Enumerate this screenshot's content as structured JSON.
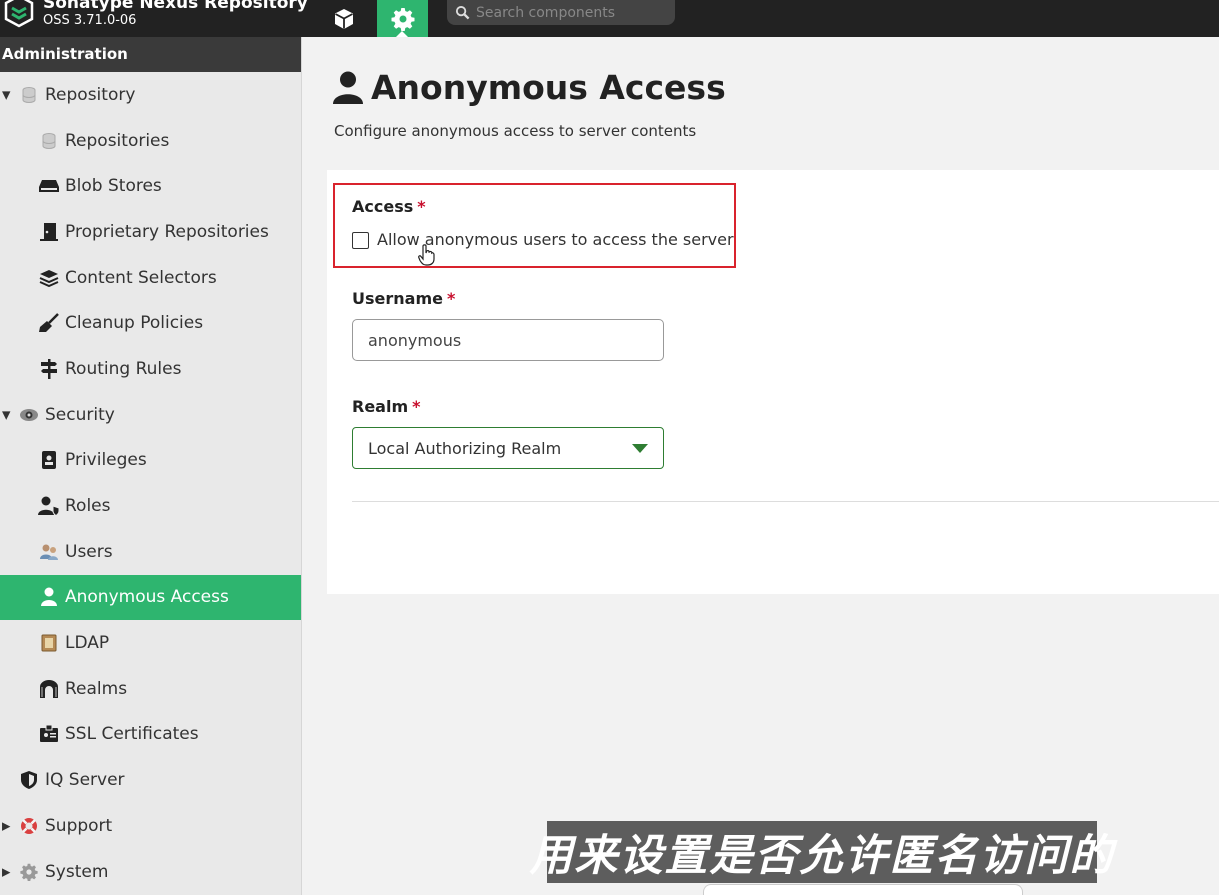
{
  "header": {
    "app_title": "Sonatype Nexus Repository",
    "version": "OSS 3.71.0-06",
    "search_placeholder": "Search components"
  },
  "sidebar": {
    "title": "Administration",
    "items": [
      {
        "label": "Repository",
        "level": 1,
        "expanded": true,
        "icon": "database-icon"
      },
      {
        "label": "Repositories",
        "level": 2,
        "icon": "database-icon"
      },
      {
        "label": "Blob Stores",
        "level": 2,
        "icon": "hard-drive-icon"
      },
      {
        "label": "Proprietary Repositories",
        "level": 2,
        "icon": "door-icon"
      },
      {
        "label": "Content Selectors",
        "level": 2,
        "icon": "layers-icon"
      },
      {
        "label": "Cleanup Policies",
        "level": 2,
        "icon": "broom-icon"
      },
      {
        "label": "Routing Rules",
        "level": 2,
        "icon": "signpost-icon"
      },
      {
        "label": "Security",
        "level": 1,
        "expanded": true,
        "icon": "eye-icon"
      },
      {
        "label": "Privileges",
        "level": 2,
        "icon": "id-badge-icon"
      },
      {
        "label": "Roles",
        "level": 2,
        "icon": "user-shield-icon"
      },
      {
        "label": "Users",
        "level": 2,
        "icon": "users-icon"
      },
      {
        "label": "Anonymous Access",
        "level": 2,
        "active": true,
        "icon": "user-icon"
      },
      {
        "label": "LDAP",
        "level": 2,
        "icon": "address-book-icon"
      },
      {
        "label": "Realms",
        "level": 2,
        "icon": "archway-icon"
      },
      {
        "label": "SSL Certificates",
        "level": 2,
        "icon": "id-card-icon"
      },
      {
        "label": "IQ Server",
        "level": 1,
        "icon": "shield-icon"
      },
      {
        "label": "Support",
        "level": 1,
        "expanded": false,
        "icon": "lifebuoy-icon"
      },
      {
        "label": "System",
        "level": 1,
        "expanded": false,
        "icon": "gear-icon"
      }
    ]
  },
  "page": {
    "title": "Anonymous Access",
    "subtitle": "Configure anonymous access to server contents",
    "access_label": "Access",
    "access_checkbox_label": "Allow anonymous users to access the server",
    "access_checked": false,
    "username_label": "Username",
    "username_value": "anonymous",
    "realm_label": "Realm",
    "realm_value": "Local Authorizing Realm",
    "required_mark": "*"
  },
  "overlay": {
    "caption": "用来设置是否允许匿名访问的"
  },
  "colors": {
    "accent": "#2eb56f",
    "topbar": "#222222",
    "highlight": "#d9232d",
    "required": "#c8102e"
  }
}
